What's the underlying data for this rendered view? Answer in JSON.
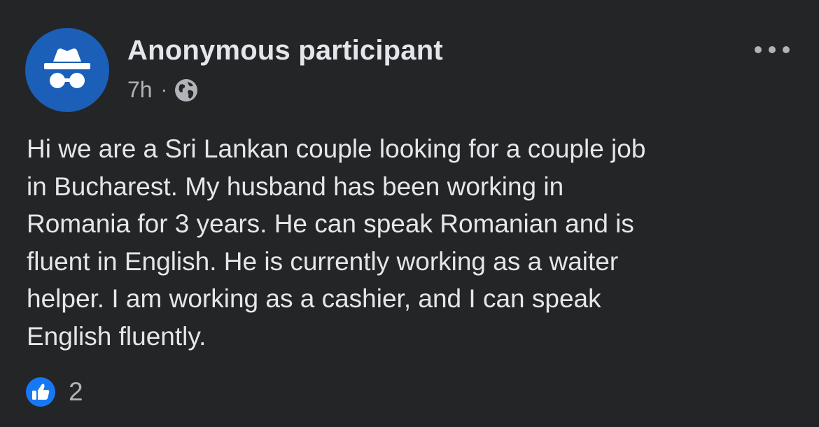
{
  "post": {
    "author": "Anonymous participant",
    "avatar_icon": "incognito-icon",
    "time": "7h",
    "separator": "·",
    "audience_icon": "globe-icon",
    "more_icon": "ellipsis-icon",
    "text_lines": [
      "Hi we are a Sri Lankan couple looking for a couple job",
      "in Bucharest. My husband has been working in",
      "Romania for 3 years. He can speak Romanian and is",
      "fluent in English. He is currently working as a waiter",
      "helper. I am working as a cashier, and I can speak",
      "English fluently."
    ],
    "reactions": {
      "icon": "thumbs-up-icon",
      "count": "2"
    }
  },
  "colors": {
    "background": "#242526",
    "text_primary": "#e4e6eb",
    "text_secondary": "#b0b3b8",
    "avatar_bg": "#1b5fb8",
    "like_blue": "#1877f2"
  }
}
